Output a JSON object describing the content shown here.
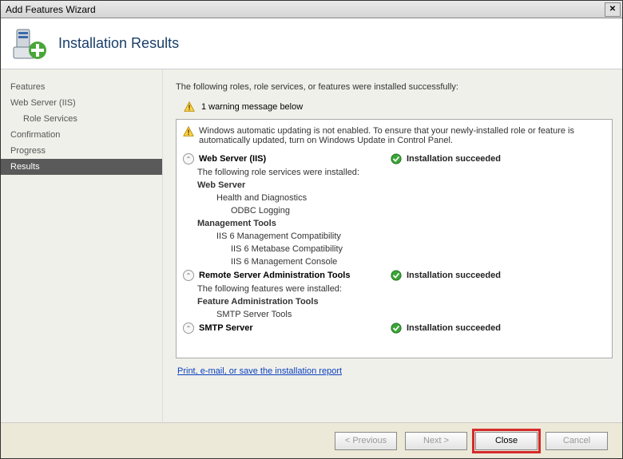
{
  "window": {
    "title": "Add Features Wizard"
  },
  "header": {
    "title": "Installation Results"
  },
  "sidebar": {
    "items": [
      {
        "label": "Features",
        "active": false,
        "indent": false
      },
      {
        "label": "Web Server (IIS)",
        "active": false,
        "indent": false
      },
      {
        "label": "Role Services",
        "active": false,
        "indent": true
      },
      {
        "label": "Confirmation",
        "active": false,
        "indent": false
      },
      {
        "label": "Progress",
        "active": false,
        "indent": false
      },
      {
        "label": "Results",
        "active": true,
        "indent": false
      }
    ]
  },
  "main": {
    "intro": "The following roles, role services, or features were installed successfully:",
    "warning_summary": "1 warning message below",
    "notice": "Windows automatic updating is not enabled. To ensure that your newly-installed role or feature is automatically updated, turn on Windows Update in Control Panel.",
    "status_text": "Installation succeeded",
    "sections": [
      {
        "title": "Web Server (IIS)",
        "subtitle": "The following role services were installed:",
        "groups": [
          {
            "name": "Web Server",
            "items": [
              "Health and Diagnostics",
              "ODBC Logging"
            ],
            "nested": true
          },
          {
            "name": "Management Tools",
            "items": [
              "IIS 6 Management Compatibility",
              "IIS 6 Metabase Compatibility",
              "IIS 6 Management Console"
            ],
            "nested": true
          }
        ]
      },
      {
        "title": "Remote Server Administration Tools",
        "subtitle": "The following features were installed:",
        "groups": [
          {
            "name": "Feature Administration Tools",
            "items": [
              "SMTP Server Tools"
            ],
            "nested": false
          }
        ]
      },
      {
        "title": "SMTP Server",
        "subtitle": "",
        "groups": []
      }
    ],
    "report_link": "Print, e-mail, or save the installation report"
  },
  "buttons": {
    "previous": "< Previous",
    "next": "Next >",
    "close": "Close",
    "cancel": "Cancel"
  }
}
